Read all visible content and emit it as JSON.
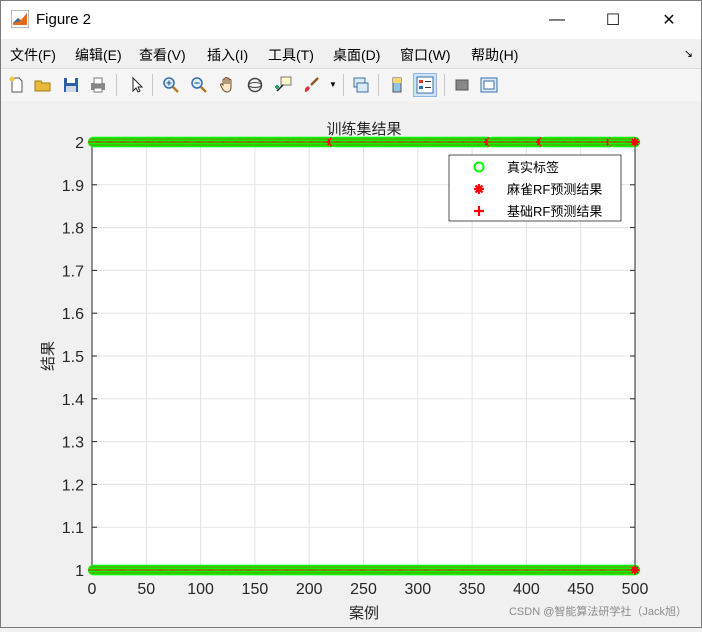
{
  "window": {
    "title": "Figure 2",
    "controls": {
      "minimize": "—",
      "maximize": "☐",
      "close": "✕"
    }
  },
  "menu": {
    "items": [
      "文件(F)",
      "编辑(E)",
      "查看(V)",
      "插入(I)",
      "工具(T)",
      "桌面(D)",
      "窗口(W)",
      "帮助(H)"
    ],
    "overflow_arrow": "↘"
  },
  "toolbar": {
    "icons": [
      "new-figure-icon",
      "open-file-icon",
      "save-icon",
      "print-icon",
      "pointer-icon",
      "zoom-in-icon",
      "zoom-out-icon",
      "pan-hand-icon",
      "rotate-3d-icon",
      "data-cursor-icon",
      "brush-icon",
      "link-plot-icon",
      "colorbar-icon",
      "legend-icon",
      "hide-plot-tools-icon",
      "show-plot-tools-icon"
    ],
    "active": "legend-icon"
  },
  "chart_data": {
    "type": "scatter",
    "title": "训练集结果",
    "xlabel": "案例",
    "ylabel": "结果",
    "xlim": [
      0,
      500
    ],
    "ylim": [
      1,
      2
    ],
    "xticks": [
      0,
      50,
      100,
      150,
      200,
      250,
      300,
      350,
      400,
      450,
      500
    ],
    "yticks": [
      1,
      1.1,
      1.2,
      1.3,
      1.4,
      1.5,
      1.6,
      1.7,
      1.8,
      1.9,
      2
    ],
    "ytick_labels": [
      "1",
      "1.1",
      "1.2",
      "1.3",
      "1.4",
      "1.5",
      "1.6",
      "1.7",
      "1.8",
      "1.9",
      "2"
    ],
    "grid": true,
    "legend_position": "top-right",
    "series": [
      {
        "name": "真实标签",
        "marker": "circle-open",
        "color": "#00ff00"
      },
      {
        "name": "麻雀RF预测结果",
        "marker": "asterisk",
        "color": "#ff0000"
      },
      {
        "name": "基础RF预测结果",
        "marker": "plus",
        "color": "#ff0000"
      }
    ],
    "values_note_y1_x_ranges": [
      [
        0,
        500
      ]
    ],
    "values_note_y2_x_ranges": [
      [
        0,
        220
      ],
      [
        224,
        365
      ],
      [
        369,
        413
      ],
      [
        417,
        477
      ],
      [
        480,
        500
      ]
    ],
    "num_samples": 500
  },
  "watermark": "CSDN @智能算法研学社（Jack旭）"
}
